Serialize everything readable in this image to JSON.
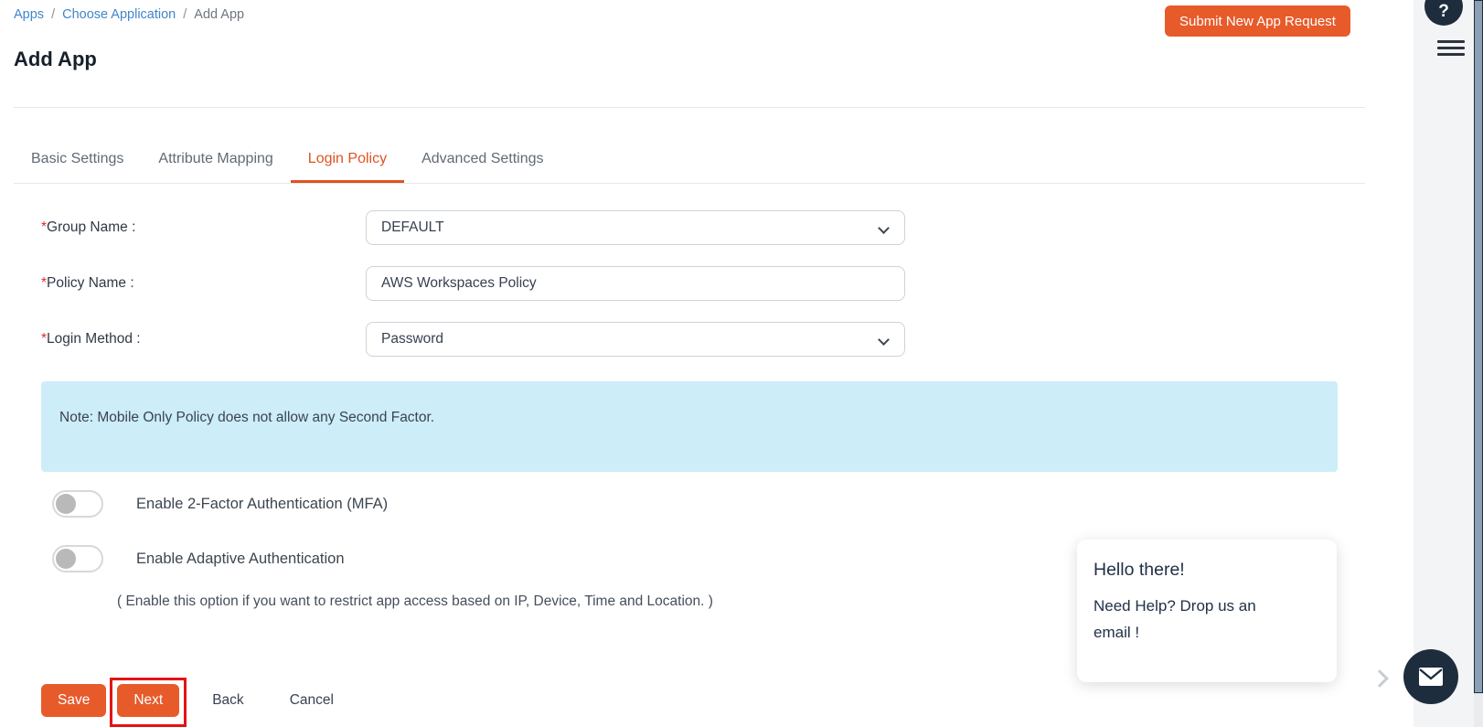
{
  "breadcrumb": {
    "separator": "/",
    "items": [
      {
        "label": "Apps"
      },
      {
        "label": "Choose Application"
      },
      {
        "label": "Add App"
      }
    ]
  },
  "header": {
    "title": "Add App",
    "submit_button_label": "Submit New App Request"
  },
  "rail": {
    "help_label": "?"
  },
  "tabs": [
    {
      "label": "Basic Settings",
      "active": false
    },
    {
      "label": "Attribute Mapping",
      "active": false
    },
    {
      "label": "Login Policy",
      "active": true
    },
    {
      "label": "Advanced Settings",
      "active": false
    }
  ],
  "form": {
    "group_name": {
      "required_mark": "*",
      "label": "Group Name :",
      "value": "DEFAULT",
      "type": "select"
    },
    "policy_name": {
      "required_mark": "*",
      "label": "Policy Name :",
      "value": "AWS Workspaces Policy",
      "type": "text"
    },
    "login_method": {
      "required_mark": "*",
      "label": "Login Method :",
      "value": "Password",
      "type": "select"
    }
  },
  "note": {
    "text": "Note: Mobile Only Policy does not allow any Second Factor."
  },
  "toggles": [
    {
      "label": "Enable 2-Factor Authentication (MFA)",
      "state": "off"
    },
    {
      "label": "Enable Adaptive Authentication",
      "state": "off"
    }
  ],
  "adaptive_hint": "( Enable this option if you want to restrict app access based on IP, Device, Time and Location. )",
  "actions": {
    "save": "Save",
    "next": "Next",
    "back": "Back",
    "cancel": "Cancel"
  },
  "chat": {
    "greeting": "Hello there!",
    "message_line1": "Need Help? Drop us an",
    "message_line2": "email !",
    "icon": "mail-icon"
  },
  "colors": {
    "accent_orange": "#e75b2b",
    "highlight_red": "#e31414",
    "note_bg": "#cdedf8",
    "link_blue": "#4285c9",
    "dark_navy": "#1d2d3e",
    "scrollbar_thumb": "#8ba0b5"
  }
}
